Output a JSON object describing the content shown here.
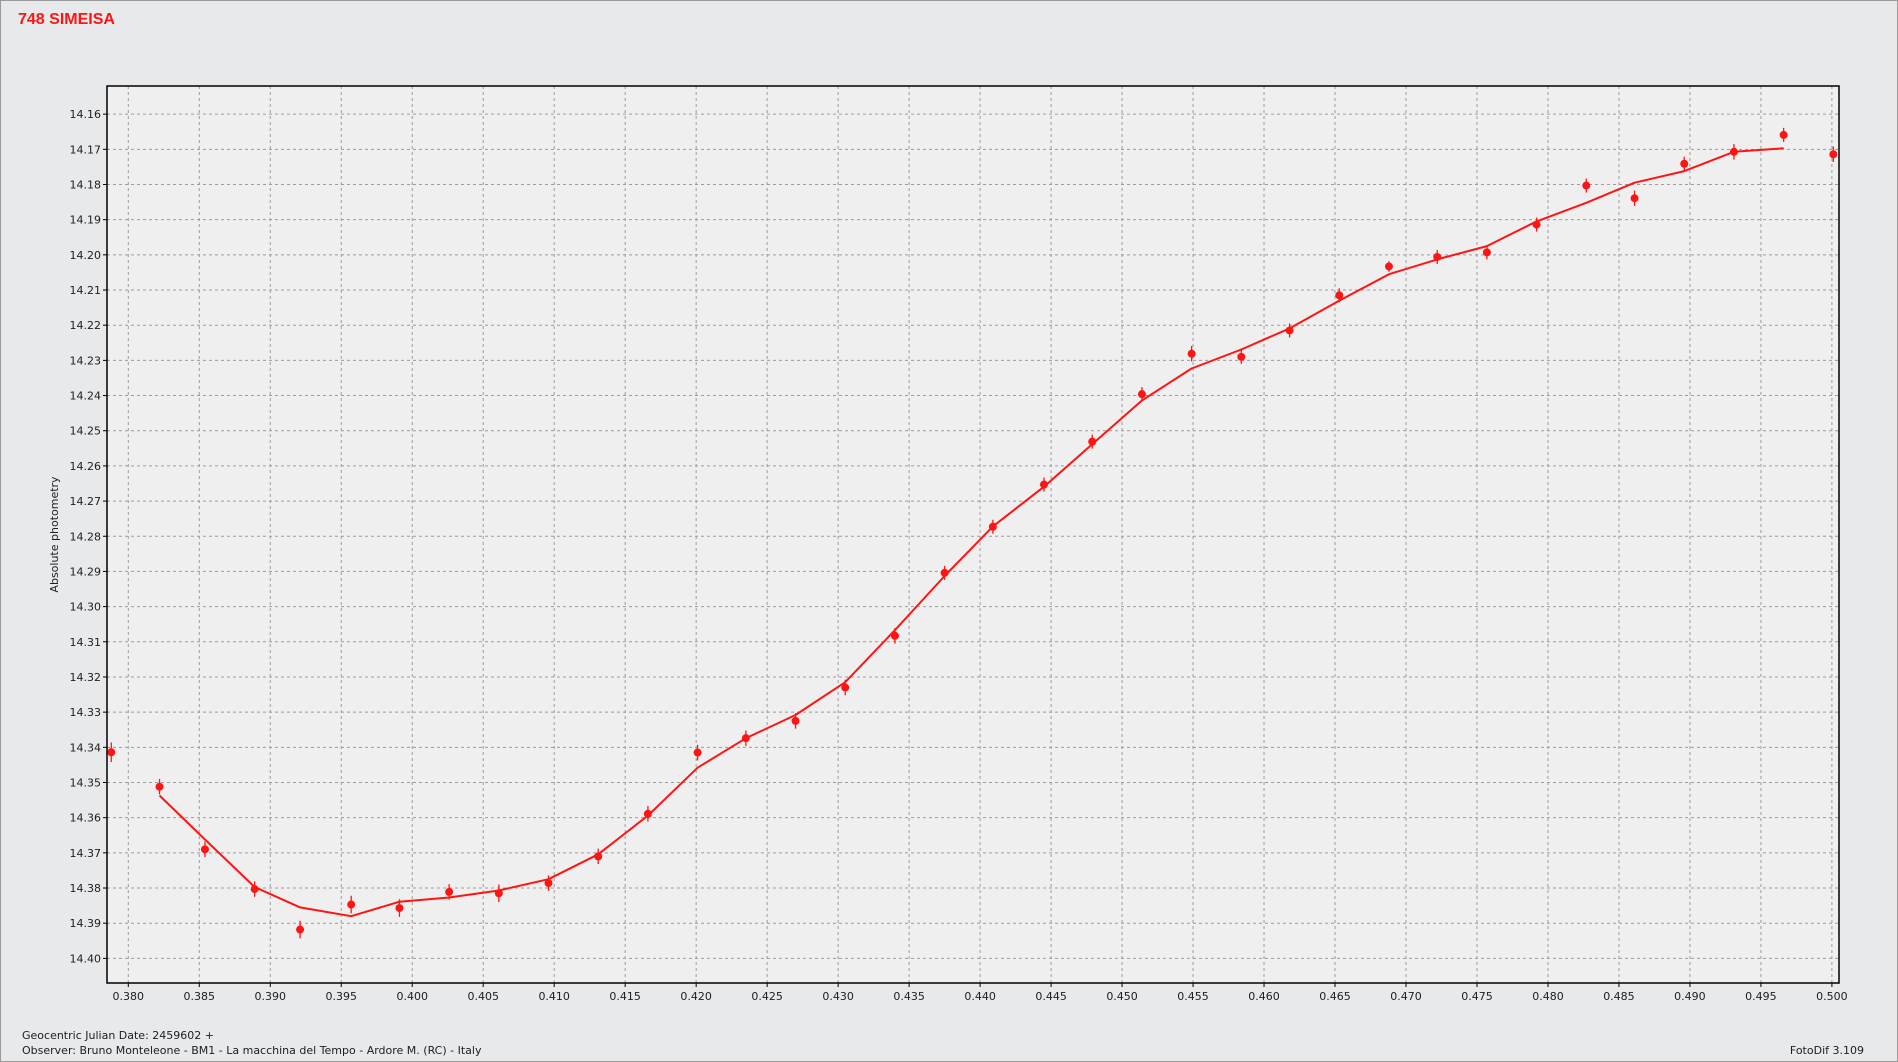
{
  "header": {
    "title": "748 SIMEISA"
  },
  "footer": {
    "jd_label": "Geocentric Julian Date: 2459602 +",
    "observer": "Observer: Bruno Monteleone - BM1 - La macchina del Tempo - Ardore M. (RC) - Italy",
    "version": "FotoDif 3.109"
  },
  "colors": {
    "series": "#ff1414",
    "grid": "#9c9c9c",
    "background": "#e8e9ea",
    "plot_background": "#efefef"
  },
  "chart_data": {
    "type": "scatter",
    "title": "748 SIMEISA",
    "xlabel": "",
    "ylabel": "Absolute photometry",
    "xlim": [
      0.3785,
      0.5005
    ],
    "ylim": [
      14.152,
      14.407
    ],
    "y_inverted": true,
    "grid": true,
    "xticks": [
      "0.380",
      "0.385",
      "0.390",
      "0.395",
      "0.400",
      "0.405",
      "0.410",
      "0.415",
      "0.420",
      "0.425",
      "0.430",
      "0.435",
      "0.440",
      "0.445",
      "0.450",
      "0.455",
      "0.460",
      "0.465",
      "0.470",
      "0.475",
      "0.480",
      "0.485",
      "0.490",
      "0.495",
      "0.500"
    ],
    "yticks": [
      "14.16",
      "14.17",
      "14.18",
      "14.19",
      "14.20",
      "14.21",
      "14.22",
      "14.23",
      "14.24",
      "14.25",
      "14.26",
      "14.27",
      "14.28",
      "14.29",
      "14.30",
      "14.31",
      "14.32",
      "14.33",
      "14.34",
      "14.35",
      "14.36",
      "14.37",
      "14.38",
      "14.39",
      "14.40"
    ],
    "series": [
      {
        "kind": "points_with_error",
        "x": [
          0.3788,
          0.3822,
          0.3854,
          0.3889,
          0.3921,
          0.3957,
          0.3991,
          0.4026,
          0.4061,
          0.4096,
          0.4131,
          0.4166,
          0.4201,
          0.4235,
          0.427,
          0.4305,
          0.434,
          0.4375,
          0.4409,
          0.4445,
          0.4479,
          0.4514,
          0.4549,
          0.4584,
          0.4618,
          0.4653,
          0.4688,
          0.4722,
          0.4757,
          0.4792,
          0.4827,
          0.4861,
          0.4896,
          0.4931,
          0.4966,
          0.5001
        ],
        "y": [
          14.3414,
          14.3512,
          14.369,
          14.3803,
          14.3918,
          14.3847,
          14.3857,
          14.3811,
          14.3815,
          14.3786,
          14.371,
          14.3589,
          14.3415,
          14.3374,
          14.3325,
          14.323,
          14.3083,
          14.2904,
          14.2773,
          14.2653,
          14.2531,
          14.2396,
          14.2281,
          14.229,
          14.2215,
          14.2115,
          14.2033,
          14.2006,
          14.1993,
          14.1914,
          14.1803,
          14.1839,
          14.1741,
          14.1707,
          14.1659,
          14.1714
        ],
        "err": [
          0.0028,
          0.0022,
          0.0022,
          0.0022,
          0.0025,
          0.0025,
          0.0025,
          0.0022,
          0.0025,
          0.0022,
          0.0022,
          0.0022,
          0.0022,
          0.0022,
          0.0022,
          0.0022,
          0.0022,
          0.002,
          0.002,
          0.002,
          0.002,
          0.002,
          0.0022,
          0.002,
          0.002,
          0.002,
          0.0015,
          0.002,
          0.002,
          0.002,
          0.002,
          0.0022,
          0.002,
          0.0022,
          0.002,
          0.0022
        ]
      },
      {
        "kind": "fit_line",
        "x": [
          0.3822,
          0.3854,
          0.3889,
          0.3921,
          0.3957,
          0.3991,
          0.4026,
          0.4061,
          0.4096,
          0.4131,
          0.4166,
          0.4201,
          0.4235,
          0.427,
          0.4305,
          0.434,
          0.4375,
          0.4409,
          0.4445,
          0.4479,
          0.4514,
          0.4549,
          0.4584,
          0.4618,
          0.4653,
          0.4688,
          0.4722,
          0.4757,
          0.4792,
          0.4827,
          0.4861,
          0.4896,
          0.4931,
          0.4966
        ],
        "y": [
          14.3537,
          14.3662,
          14.3797,
          14.3855,
          14.388,
          14.3839,
          14.3827,
          14.3807,
          14.3775,
          14.3704,
          14.3594,
          14.3458,
          14.3374,
          14.3308,
          14.3215,
          14.3067,
          14.2913,
          14.2772,
          14.2659,
          14.2538,
          14.2414,
          14.2323,
          14.2269,
          14.2209,
          14.213,
          14.2055,
          14.2013,
          14.1975,
          14.1905,
          14.1852,
          14.1795,
          14.1762,
          14.1707,
          14.1697
        ]
      }
    ]
  }
}
